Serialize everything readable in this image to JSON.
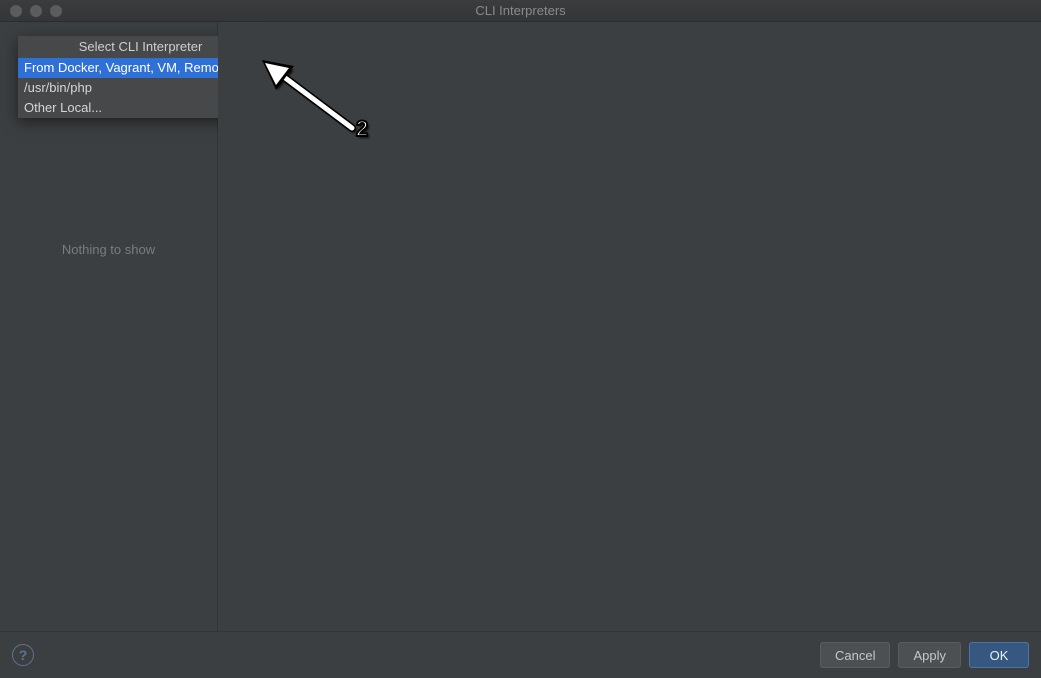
{
  "window": {
    "title": "CLI Interpreters"
  },
  "left": {
    "empty_text": "Nothing to show"
  },
  "popup": {
    "title": "Select CLI Interpreter",
    "items": [
      {
        "label": "From Docker, Vagrant, VM, Remote...",
        "selected": true
      },
      {
        "label": "/usr/bin/php",
        "selected": false
      },
      {
        "label": "Other Local...",
        "selected": false
      }
    ]
  },
  "footer": {
    "help": "?",
    "cancel": "Cancel",
    "apply": "Apply",
    "ok": "OK"
  },
  "annotation": {
    "label": "2"
  }
}
